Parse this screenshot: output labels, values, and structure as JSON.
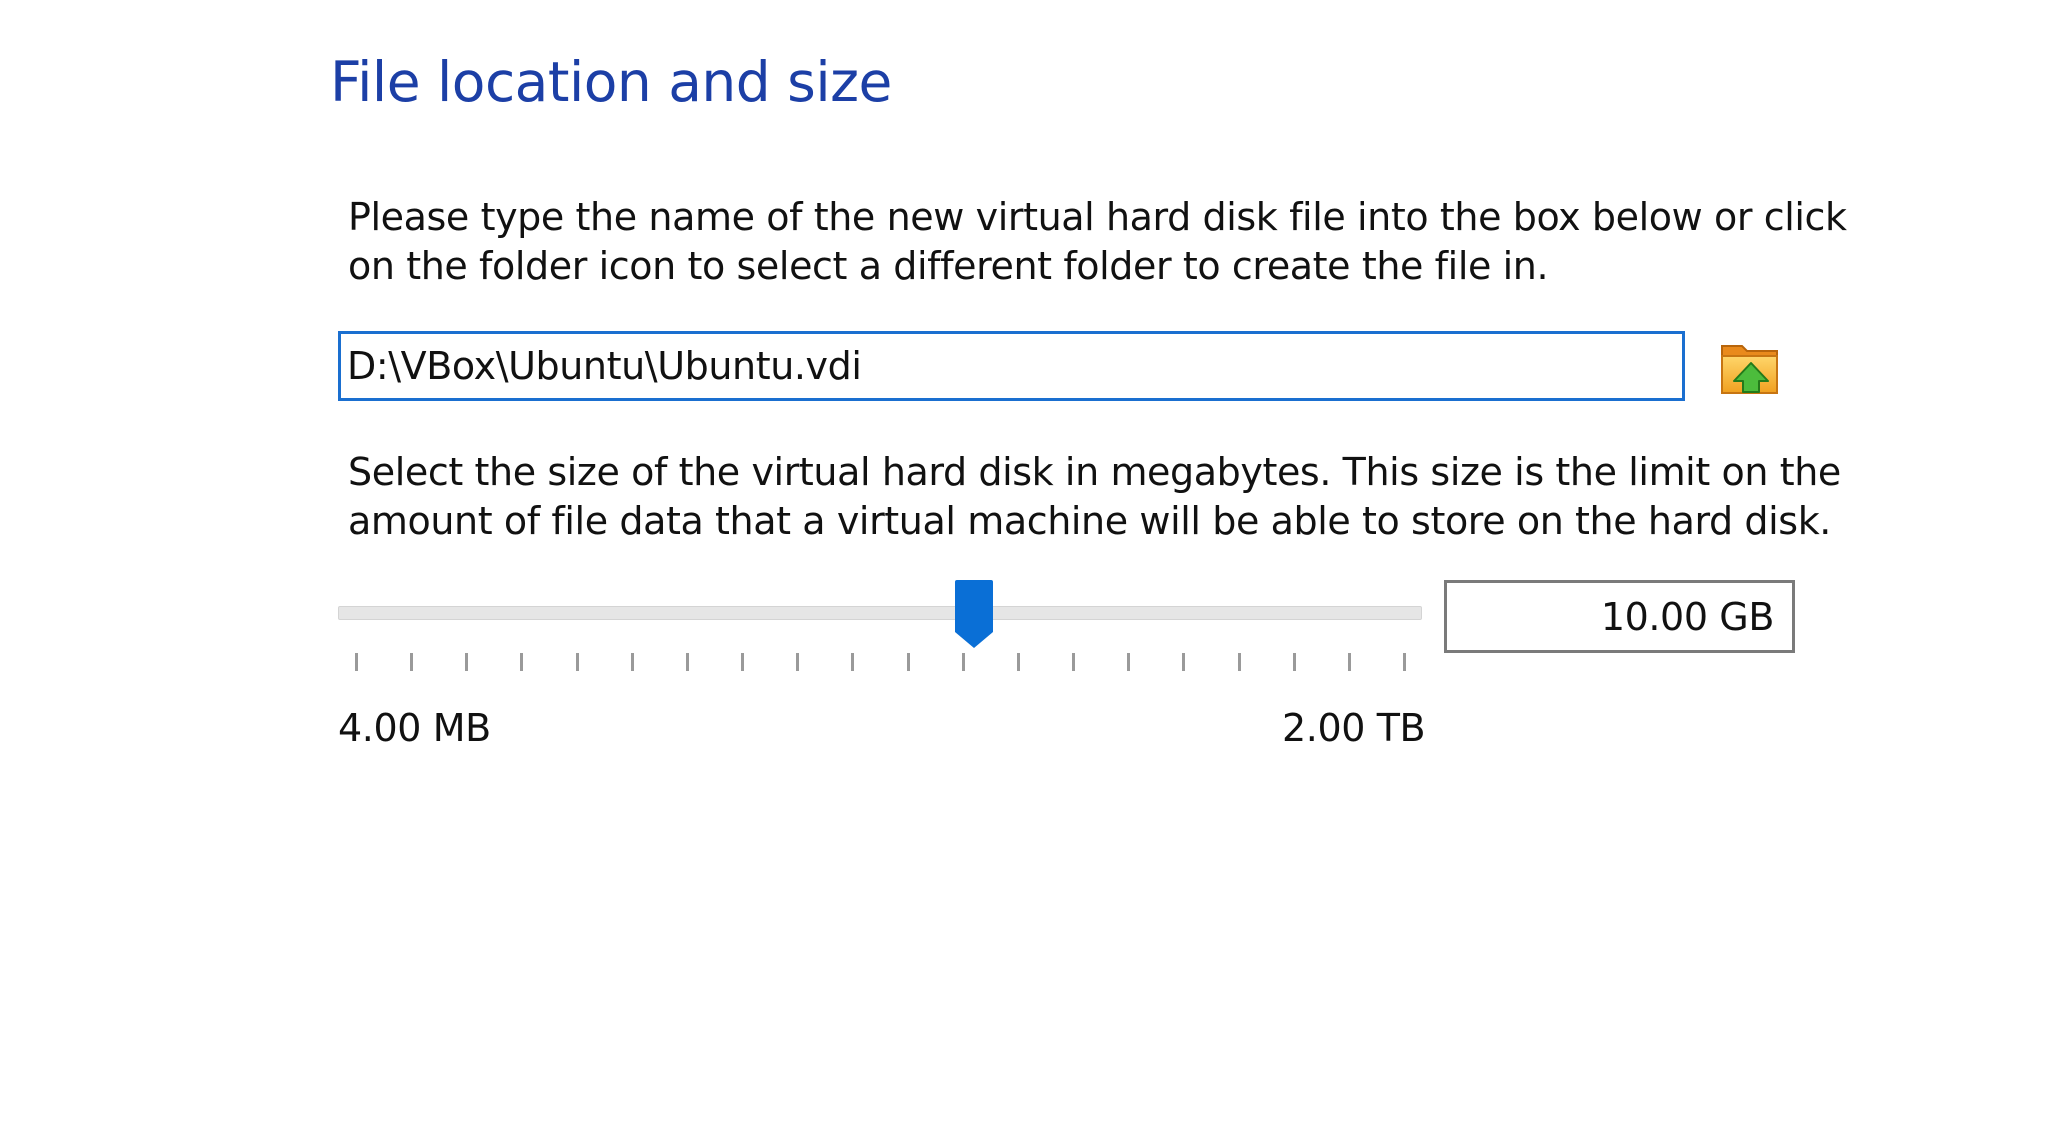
{
  "page": {
    "title": "File location and size"
  },
  "location": {
    "instruction": [
      "Please type the name of the new virtual hard disk file into the box below or click",
      "on the folder icon to select a different folder to create the file in."
    ],
    "file_path": "D:\\VBox\\Ubuntu\\Ubuntu.vdi",
    "folder_button_icon": "folder-icon"
  },
  "size": {
    "instruction": [
      "Select the size of the virtual hard disk in megabytes. This size is the limit on the",
      "amount of file data that a virtual machine will be able to store on the hard disk."
    ],
    "value_text": "10.00 GB",
    "min_label": "4.00 MB",
    "max_label": "2.00 TB",
    "slider_fraction": 0.59,
    "tick_count": 20,
    "handle_color": "#0a6fd6"
  },
  "colors": {
    "title": "#1c3fa6",
    "input_focus_border": "#1a6fd0"
  }
}
